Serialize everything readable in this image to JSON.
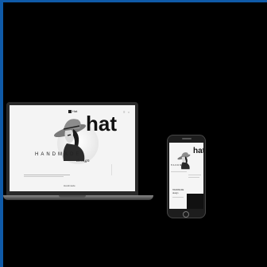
{
  "laptop": {
    "brand": "Hat",
    "hero_title": "hat",
    "hero_subtitle": "HANDMADE",
    "hero_script": "design",
    "footer_label": "Handmade"
  },
  "phone": {
    "hero_title": "hat",
    "hero_subtitle": "HANDMADE",
    "block_label": "HANDMADE",
    "block_label2": "design"
  },
  "colors": {
    "frame": "#0f5aa8",
    "background": "#000000"
  }
}
